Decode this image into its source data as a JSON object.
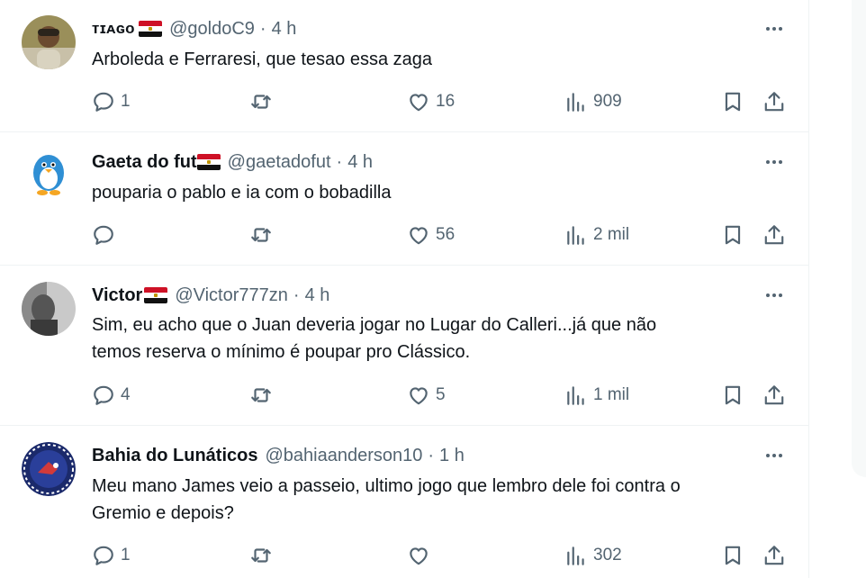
{
  "replies": [
    {
      "name": "ᴛɪᴀɢᴏ",
      "handle": "@goldoC9",
      "dot": "·",
      "time": "4 h",
      "text": "Arboleda e Ferraresi, que tesao essa zaga",
      "text2": "",
      "reply_count": "1",
      "repost_count": "",
      "like_count": "16",
      "view_count": "909"
    },
    {
      "name": "Gaeta do fut",
      "handle": "@gaetadofut",
      "dot": "·",
      "time": "4 h",
      "text": "pouparia o pablo e ia com o bobadilla",
      "text2": "",
      "reply_count": "",
      "repost_count": "",
      "like_count": "56",
      "view_count": "2 mil"
    },
    {
      "name": "Victor",
      "handle": "@Victor777zn",
      "dot": "·",
      "time": "4 h",
      "text": "Sim, eu acho que o Juan deveria jogar no Lugar do Calleri...já que não",
      "text2": "temos reserva o mínimo é poupar pro Clássico.",
      "reply_count": "4",
      "repost_count": "",
      "like_count": "5",
      "view_count": "1 mil"
    },
    {
      "name": "Bahia do Lunáticos",
      "handle": "@bahiaanderson10",
      "dot": "·",
      "time": "1 h",
      "text": "Meu mano James veio a passeio, ultimo jogo que lembro dele foi contra o",
      "text2": "Gremio e depois?",
      "reply_count": "1",
      "repost_count": "",
      "like_count": "",
      "view_count": "302"
    }
  ],
  "icons": {
    "more": "more-dots-icon",
    "reply": "reply-bubble-icon",
    "repost": "repost-arrows-icon",
    "like": "heart-icon",
    "views": "views-bars-icon",
    "bookmark": "bookmark-icon",
    "share": "share-upload-icon"
  },
  "colors": {
    "text": "#0f1419",
    "secondary": "#536471",
    "divider": "#eff3f4"
  }
}
